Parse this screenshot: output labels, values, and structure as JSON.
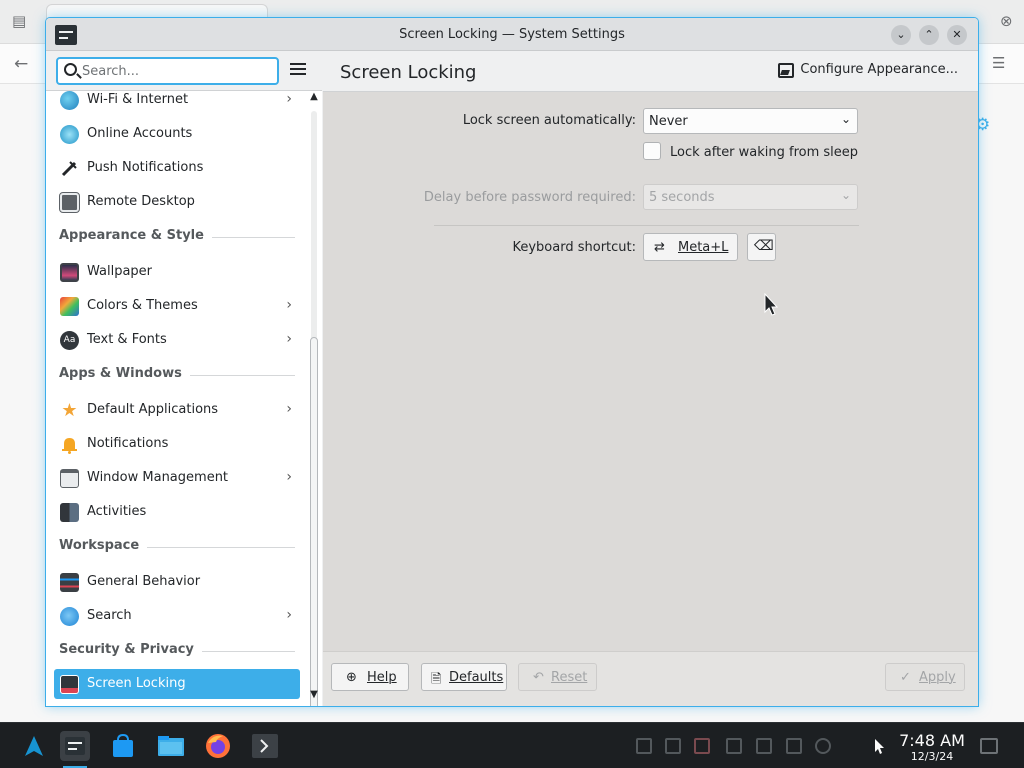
{
  "window": {
    "title": "Screen Locking — System Settings"
  },
  "sidebar": {
    "search_placeholder": "Search...",
    "items": [
      {
        "label": "Wi-Fi & Internet",
        "icon": "globe-icon",
        "chevron": true
      },
      {
        "label": "Online Accounts",
        "icon": "online-accounts-icon",
        "chevron": false
      },
      {
        "label": "Push Notifications",
        "icon": "pin-icon",
        "chevron": false
      },
      {
        "label": "Remote Desktop",
        "icon": "remote-desktop-icon",
        "chevron": false
      },
      {
        "section": "Appearance & Style"
      },
      {
        "label": "Wallpaper",
        "icon": "wallpaper-icon",
        "chevron": false
      },
      {
        "label": "Colors & Themes",
        "icon": "colors-themes-icon",
        "chevron": true
      },
      {
        "label": "Text & Fonts",
        "icon": "fonts-icon",
        "chevron": true
      },
      {
        "section": "Apps & Windows"
      },
      {
        "label": "Default Applications",
        "icon": "star-icon",
        "chevron": true
      },
      {
        "label": "Notifications",
        "icon": "bell-icon",
        "chevron": false
      },
      {
        "label": "Window Management",
        "icon": "window-icon",
        "chevron": true
      },
      {
        "label": "Activities",
        "icon": "activities-icon",
        "chevron": false
      },
      {
        "section": "Workspace"
      },
      {
        "label": "General Behavior",
        "icon": "sliders-icon",
        "chevron": false
      },
      {
        "label": "Search",
        "icon": "search-icon",
        "chevron": true
      },
      {
        "section": "Security & Privacy"
      },
      {
        "label": "Screen Locking",
        "icon": "lock-screen-icon",
        "chevron": false,
        "active": true
      }
    ],
    "section_appearance": "Appearance & Style",
    "section_apps": "Apps & Windows",
    "section_workspace": "Workspace",
    "section_security": "Security & Privacy"
  },
  "page": {
    "title": "Screen Locking",
    "configure_appearance": "Configure Appearance..."
  },
  "form": {
    "lock_auto_label": "Lock screen automatically:",
    "lock_auto_value": "Never",
    "lock_after_wake_label": "Lock after waking from sleep",
    "lock_after_wake_checked": false,
    "delay_label": "Delay before password required:",
    "delay_value": "5 seconds",
    "shortcut_label": "Keyboard shortcut:",
    "shortcut_value": "Meta+L"
  },
  "footer": {
    "help": "Help",
    "defaults": "Defaults",
    "reset": "Reset",
    "apply": "Apply"
  },
  "taskbar": {
    "time": "7:48 AM",
    "date": "12/3/24"
  },
  "colors": {
    "accent": "#3daee9",
    "panel": "#1c1f22"
  }
}
